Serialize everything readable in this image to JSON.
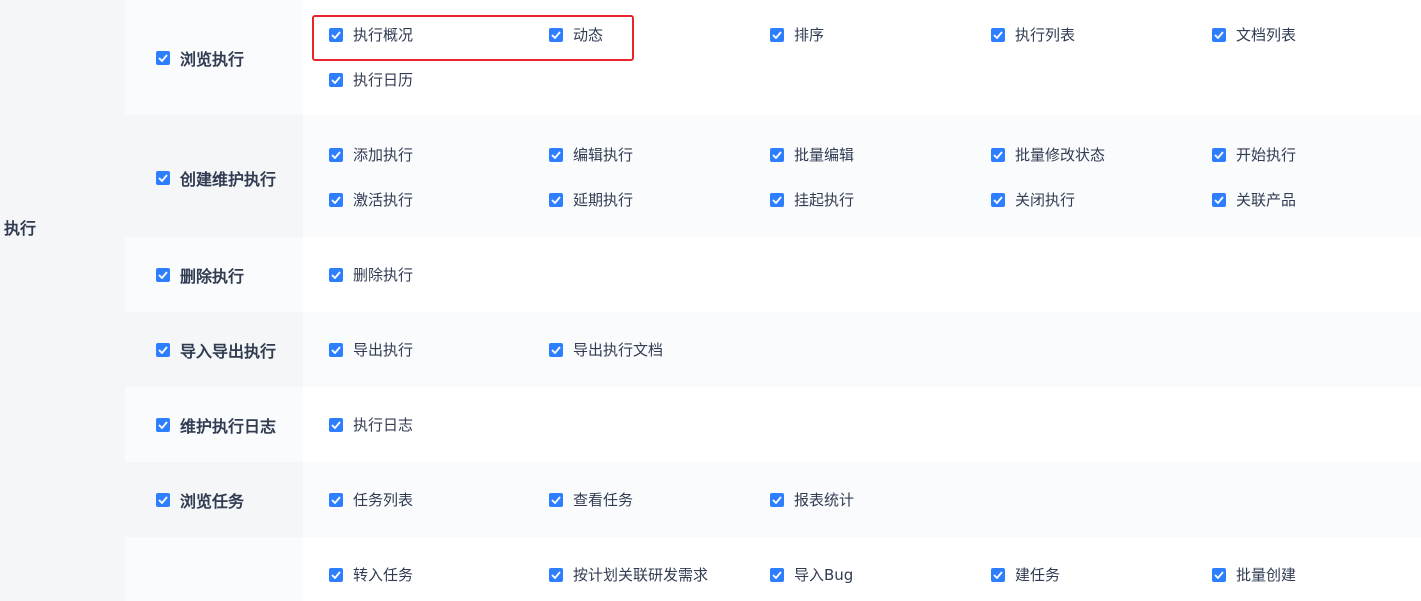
{
  "module": {
    "label": "执行"
  },
  "groups": [
    {
      "label": "浏览执行",
      "items": [
        "执行概况",
        "动态",
        "排序",
        "执行列表",
        "文档列表",
        "执行日历"
      ]
    },
    {
      "label": "创建维护执行",
      "items": [
        "添加执行",
        "编辑执行",
        "批量编辑",
        "批量修改状态",
        "开始执行",
        "激活执行",
        "延期执行",
        "挂起执行",
        "关闭执行",
        "关联产品"
      ]
    },
    {
      "label": "删除执行",
      "items": [
        "删除执行"
      ]
    },
    {
      "label": "导入导出执行",
      "items": [
        "导出执行",
        "导出执行文档"
      ]
    },
    {
      "label": "维护执行日志",
      "items": [
        "执行日志"
      ]
    },
    {
      "label": "浏览任务",
      "items": [
        "任务列表",
        "查看任务",
        "报表统计"
      ]
    },
    {
      "label": "",
      "items": [
        "转入任务",
        "按计划关联研发需求",
        "导入Bug",
        "建任务",
        "批量创建"
      ]
    }
  ],
  "colors": {
    "checkbox": "#2e7fff",
    "highlight": "#e8242c",
    "text": "#313c52"
  }
}
